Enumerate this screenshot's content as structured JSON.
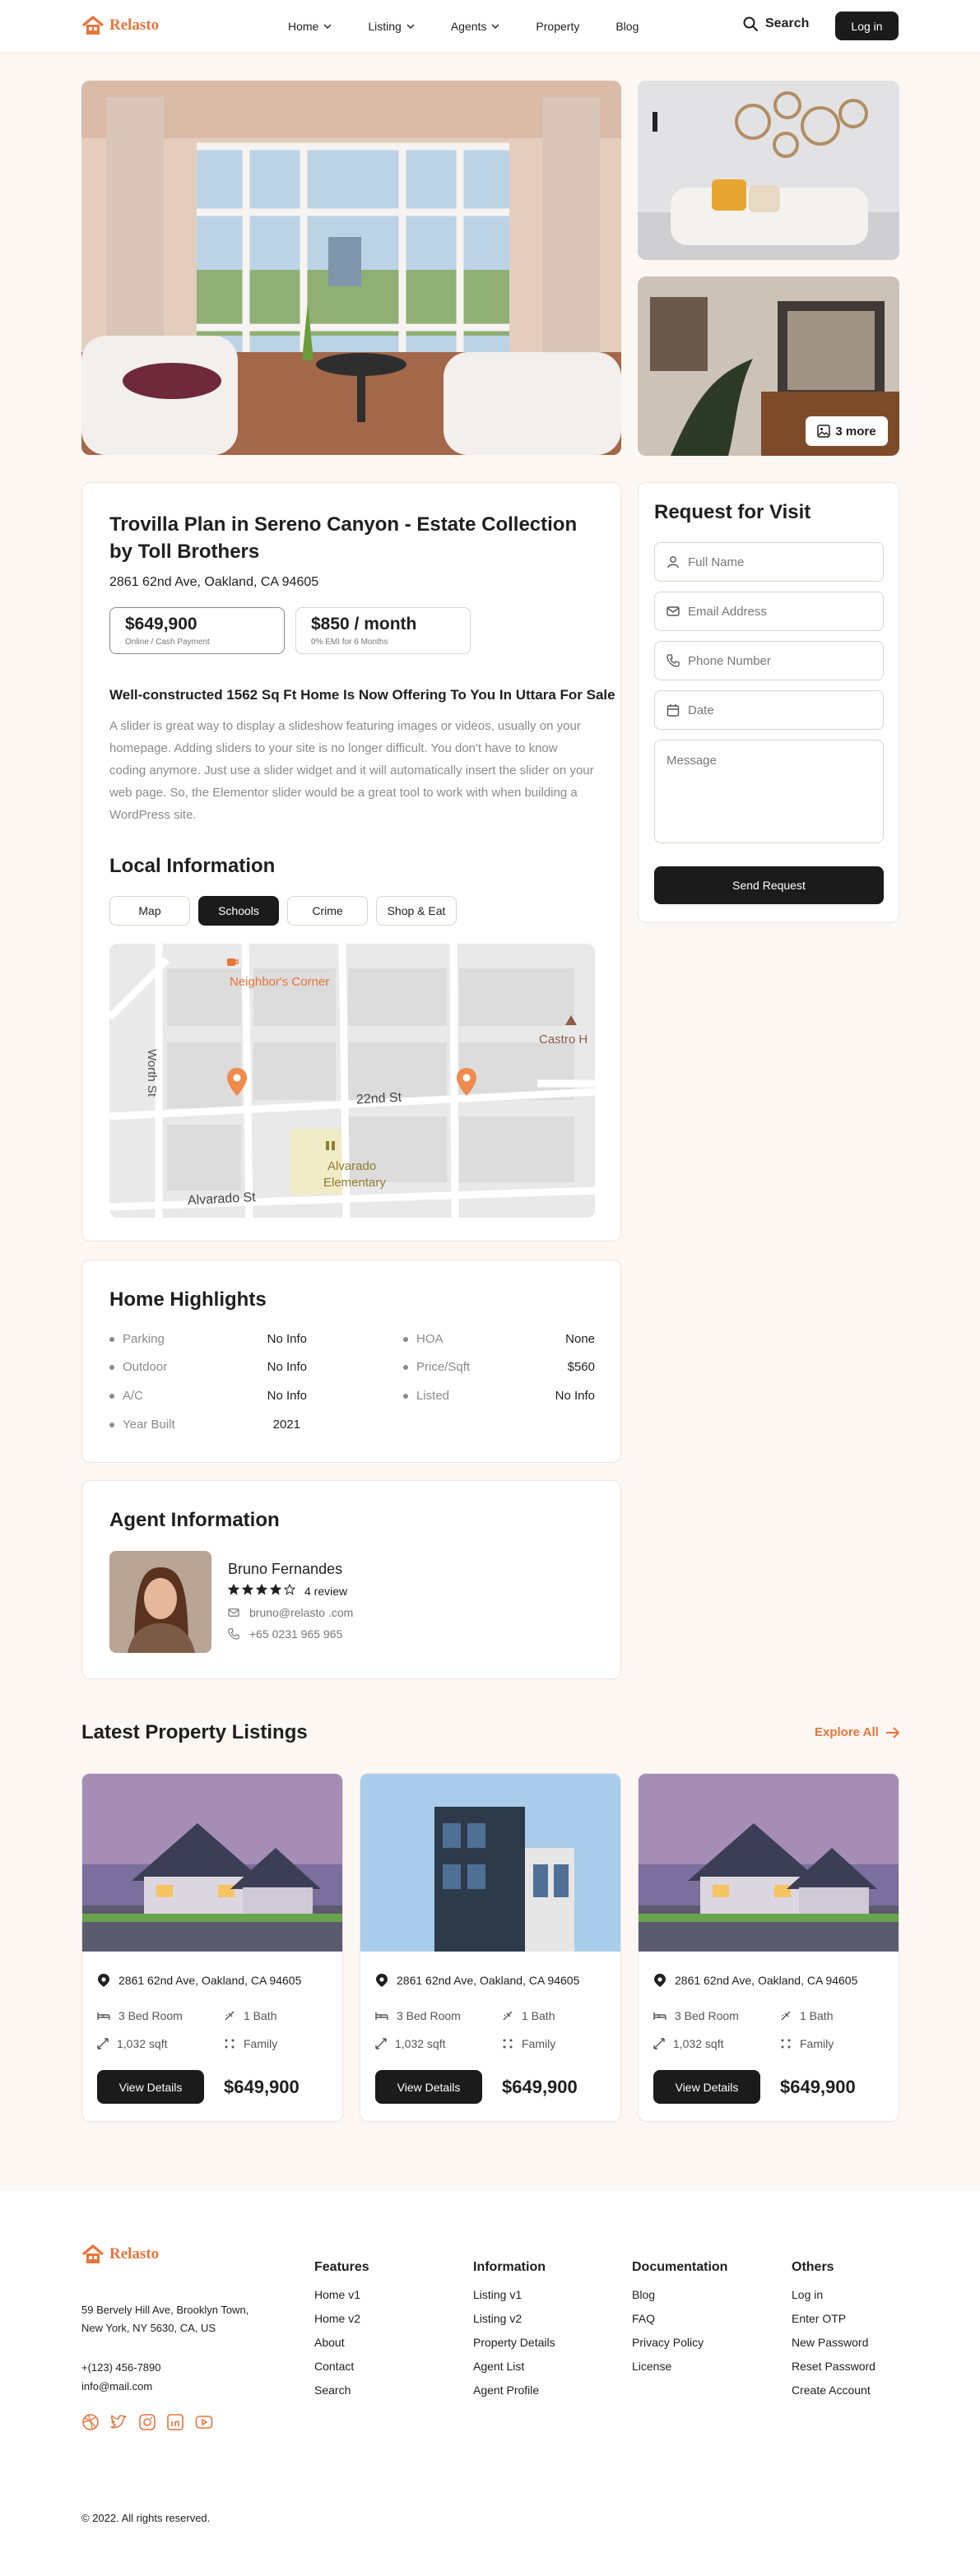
{
  "brand": {
    "name": "Relasto",
    "color": "#e8743b",
    "dark": "#1b1b1b"
  },
  "header": {
    "nav": [
      {
        "label": "Home",
        "dropdown": true
      },
      {
        "label": "Listing",
        "dropdown": true
      },
      {
        "label": "Agents",
        "dropdown": true
      },
      {
        "label": "Property",
        "dropdown": false
      },
      {
        "label": "Blog",
        "dropdown": false
      }
    ],
    "search_label": "Search",
    "login_label": "Log in"
  },
  "gallery": {
    "more_label": "3 more"
  },
  "property": {
    "title": "Trovilla Plan in Sereno Canyon - Estate Collection by Toll Brothers",
    "address": "2861 62nd Ave, Oakland, CA 94605",
    "price_cash": {
      "value": "$649,900",
      "sub": "Online / Cash Payment"
    },
    "price_month": {
      "value": "$850 / month",
      "sub": "0% EMI for 6 Months"
    },
    "headline": "Well-constructed 1562 Sq Ft Home Is Now Offering To You In Uttara For Sale",
    "description": "A slider is great way to display a slideshow featuring images or videos, usually on your homepage.   Adding sliders to your site is no longer difficult. You don't have to know coding anymore. Just use a slider widget and it will automatically insert the slider on your web page.   So, the Elementor slider would be a great tool to work with when building a WordPress site."
  },
  "local": {
    "title": "Local Information",
    "tabs": [
      "Map",
      "Schools",
      "Crime",
      "Shop & Eat"
    ],
    "active_tab": "Schools",
    "map_labels": {
      "poi1": "Neighbor's Corner",
      "poi2": "Castro H",
      "street1": "Worth St",
      "street2": "22nd St",
      "street3": "Alvarado St",
      "school_line1": "Alvarado",
      "school_line2": "Elementary"
    }
  },
  "visit": {
    "title": "Request for Visit",
    "fields": [
      "Full Name",
      "Email Address",
      "Phone Number",
      "Date"
    ],
    "message_placeholder": "Message",
    "send_label": "Send Request"
  },
  "highlights": {
    "title": "Home Highlights",
    "left": [
      {
        "k": "Parking",
        "v": "No Info"
      },
      {
        "k": "Outdoor",
        "v": "No Info"
      },
      {
        "k": "A/C",
        "v": "No Info"
      },
      {
        "k": "Year Built",
        "v": "2021"
      }
    ],
    "right": [
      {
        "k": "HOA",
        "v": "None"
      },
      {
        "k": "Price/Sqft",
        "v": "$560"
      },
      {
        "k": "Listed",
        "v": "No Info"
      }
    ]
  },
  "agent": {
    "title": "Agent Information",
    "name": "Bruno Fernandes",
    "rating": 4,
    "rating_max": 5,
    "reviews": "4 review",
    "email": "bruno@relasto .com",
    "phone": "+65 0231 965 965"
  },
  "listings": {
    "title": "Latest Property Listings",
    "explore_label": "Explore All",
    "items": [
      {
        "address": "2861 62nd Ave, Oakland, CA 94605",
        "beds": "3 Bed Room",
        "baths": "1 Bath",
        "area": "1,032 sqft",
        "type": "Family",
        "btn": "View Details",
        "price": "$649,900"
      },
      {
        "address": "2861 62nd Ave, Oakland, CA 94605",
        "beds": "3 Bed Room",
        "baths": "1 Bath",
        "area": "1,032 sqft",
        "type": "Family",
        "btn": "View Details",
        "price": "$649,900"
      },
      {
        "address": "2861 62nd Ave, Oakland, CA 94605",
        "beds": "3 Bed Room",
        "baths": "1 Bath",
        "area": "1,032 sqft",
        "type": "Family",
        "btn": "View Details",
        "price": "$649,900"
      }
    ]
  },
  "footer": {
    "address_line1": "59 Bervely Hill Ave, Brooklyn Town,",
    "address_line2": "New York, NY 5630, CA, US",
    "phone": "+(123) 456-7890",
    "email": "info@mail.com",
    "columns": [
      {
        "title": "Features",
        "links": [
          "Home v1",
          "Home v2",
          "About",
          "Contact",
          "Search"
        ]
      },
      {
        "title": "Information",
        "links": [
          "Listing v1",
          "Listing v2",
          "Property Details",
          "Agent List",
          "Agent Profile"
        ]
      },
      {
        "title": "Documentation",
        "links": [
          "Blog",
          "FAQ",
          "Privacy Policy",
          "License"
        ]
      },
      {
        "title": "Others",
        "links": [
          "Log in",
          "Enter OTP",
          "New Password",
          "Reset Password",
          "Create Account"
        ]
      }
    ],
    "social": [
      "dribbble-icon",
      "twitter-icon",
      "instagram-icon",
      "linkedin-icon",
      "youtube-icon"
    ],
    "copyright": "© 2022. All rights reserved."
  }
}
